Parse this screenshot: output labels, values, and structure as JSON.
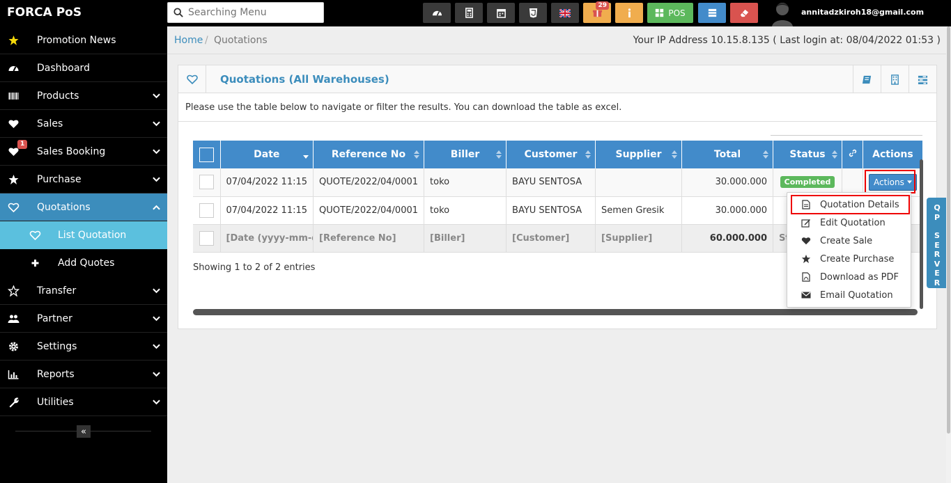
{
  "app": {
    "brand": "FORCA PoS"
  },
  "search": {
    "placeholder": "Searching Menu"
  },
  "topbar": {
    "notification_count": "29",
    "pos_label": "POS",
    "user_email": "annitadzkiroh18@gmail.com",
    "colors": {
      "dark": "#3a3a3a",
      "orange": "#f0ad4e",
      "green": "#5cb85c",
      "blue": "#428bca",
      "red": "#d9534f"
    }
  },
  "sidebar": {
    "items": [
      {
        "label": "Promotion News",
        "icon": "star-icon"
      },
      {
        "label": "Dashboard",
        "icon": "dashboard-icon"
      },
      {
        "label": "Products",
        "icon": "barcode-icon"
      },
      {
        "label": "Sales",
        "icon": "heart-icon"
      },
      {
        "label": "Sales Booking",
        "icon": "heart-icon",
        "badge": "1"
      },
      {
        "label": "Purchase",
        "icon": "star-icon"
      },
      {
        "label": "Quotations",
        "icon": "heart-outline-icon"
      },
      {
        "label": "List Quotation",
        "icon": "heart-outline-icon"
      },
      {
        "label": "Add Quotes",
        "icon": "plus-icon"
      },
      {
        "label": "Transfer",
        "icon": "star-outline-icon"
      },
      {
        "label": "Partner",
        "icon": "users-icon"
      },
      {
        "label": "Settings",
        "icon": "gear-icon"
      },
      {
        "label": "Reports",
        "icon": "bar-chart-icon"
      },
      {
        "label": "Utilities",
        "icon": "wrench-icon"
      }
    ],
    "collapse_glyph": "«"
  },
  "breadcrumb": {
    "home": "Home",
    "separator": "/",
    "current": "Quotations",
    "ip_info": "Your IP Address 10.15.8.135 ( Last login at: 08/04/2022 01:53 )"
  },
  "panel": {
    "title": "Quotations (All Warehouses)",
    "intro": "Please use the table below to navigate or filter the results. You can download the table as excel."
  },
  "table": {
    "headers": [
      "Date",
      "Reference No",
      "Biller",
      "Customer",
      "Supplier",
      "Total",
      "Status",
      "Actions"
    ],
    "rows": [
      {
        "date": "07/04/2022 11:15",
        "ref": "QUOTE/2022/04/0001",
        "biller": "toko",
        "customer": "BAYU SENTOSA",
        "supplier": "",
        "total": "30.000.000",
        "status": "Completed",
        "action": "Actions"
      },
      {
        "date": "07/04/2022 11:15",
        "ref": "QUOTE/2022/04/0001",
        "biller": "toko",
        "customer": "BAYU SENTOSA",
        "supplier": "Semen Gresik",
        "total": "30.000.000",
        "status": "",
        "action": ""
      }
    ],
    "footer": {
      "date": "[Date (yyyy-mm-d",
      "ref": "[Reference No]",
      "biller": "[Biller]",
      "customer": "[Customer]",
      "supplier": "[Supplier]",
      "total": "60.000.000",
      "status": "St"
    },
    "entries": "Showing 1 to 2 of 2 entries"
  },
  "dropdown": {
    "items": [
      {
        "label": "Quotation Details",
        "icon": "file-icon"
      },
      {
        "label": "Edit Quotation",
        "icon": "edit-icon"
      },
      {
        "label": "Create Sale",
        "icon": "heart-icon"
      },
      {
        "label": "Create Purchase",
        "icon": "star-icon"
      },
      {
        "label": "Download as PDF",
        "icon": "pdf-icon"
      },
      {
        "label": "Email Quotation",
        "icon": "envelope-icon"
      }
    ]
  },
  "side_tab": {
    "letters": [
      "Q",
      "P",
      "",
      "S",
      "E",
      "R",
      "V",
      "E",
      "R"
    ]
  }
}
